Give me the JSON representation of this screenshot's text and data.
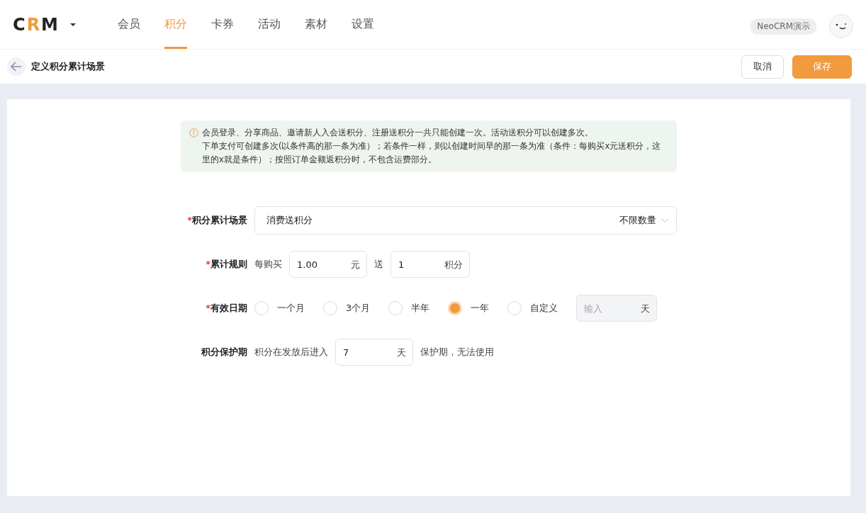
{
  "header": {
    "logo": [
      {
        "char": "C",
        "color": "#222222"
      },
      {
        "char": "R",
        "color": "#f19a3e"
      },
      {
        "char": "M",
        "color": "#222222"
      }
    ],
    "nav": [
      {
        "label": "会员",
        "selected": false
      },
      {
        "label": "积分",
        "selected": true
      },
      {
        "label": "卡券",
        "selected": false
      },
      {
        "label": "活动",
        "selected": false
      },
      {
        "label": "素材",
        "selected": false
      },
      {
        "label": "设置",
        "selected": false
      }
    ],
    "account": "NeoCRM演示"
  },
  "subheader": {
    "title": "定义积分累计场景",
    "buttons": [
      {
        "label": "取消",
        "kind": "secondary"
      },
      {
        "label": "保存",
        "kind": "primary"
      }
    ]
  },
  "notice": [
    "会员登录、分享商品、邀请新人入会送积分、注册送积分一共只能创建一次。活动送积分可以创建多次。",
    "下单支付可创建多次(以条件高的那一条为准）；若条件一样，则以创建时间早的那一条为准（条件：每购买x元送积分，这里的x就是条件）；按照订单金额返积分时，不包含运费部分。"
  ],
  "form": {
    "scene": {
      "label": "积分累计场景",
      "required_mark": "*",
      "value": "消费送积分",
      "suffix": "不限数量"
    },
    "rule": {
      "label": "累计规则",
      "required_mark": "*",
      "prefix": "每购买",
      "amount": "1.00",
      "amount_unit": "元",
      "middle": "送",
      "points": "1",
      "points_unit": "积分"
    },
    "validity": {
      "label": "有效日期",
      "required_mark": "*",
      "options": [
        {
          "label": "一个月",
          "selected": false
        },
        {
          "label": "3个月",
          "selected": false
        },
        {
          "label": "半年",
          "selected": false
        },
        {
          "label": "一年",
          "selected": true
        },
        {
          "label": "自定义",
          "selected": false
        }
      ],
      "custom": {
        "placeholder": "输入",
        "unit": "天",
        "disabled": true
      }
    },
    "protection": {
      "label": "积分保护期",
      "prefix": "积分在发放后进入",
      "value": "7",
      "unit": "天",
      "suffix": "保护期，无法使用"
    }
  }
}
